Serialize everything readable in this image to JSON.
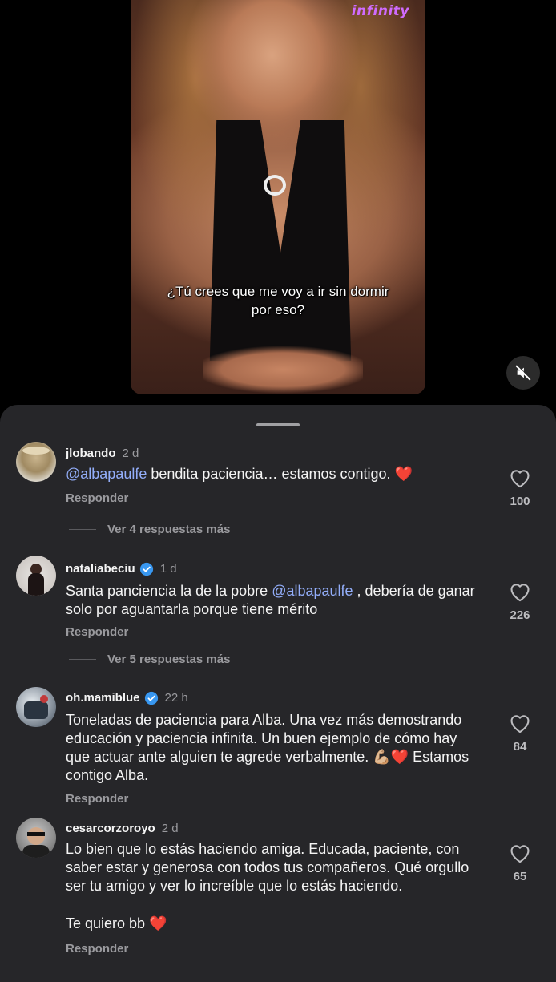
{
  "video": {
    "logo": "infinity",
    "subtitle": "¿Tú crees que me voy a ir sin dormir por eso?",
    "mute_icon": "speaker-muted-icon"
  },
  "comments": [
    {
      "username": "jlobando",
      "time": "2 d",
      "verified": false,
      "mention": "@albapaulfe",
      "text": " bendita paciencia… estamos contigo. ",
      "emoji": "❤️",
      "reply": "Responder",
      "likes": "100",
      "more_replies": "Ver 4 respuestas más"
    },
    {
      "username": "nataliabeciu",
      "time": "1 d",
      "verified": true,
      "text_before": "Santa panciencia la de la pobre ",
      "mention": "@albapaulfe",
      "text_after": " , debería de ganar solo por aguantarla porque tiene mérito",
      "reply": "Responder",
      "likes": "226",
      "more_replies": "Ver 5 respuestas más"
    },
    {
      "username": "oh.mamiblue",
      "time": "22 h",
      "verified": true,
      "text": "Toneladas de paciencia para Alba. Una vez más demostrando educación y paciencia infinita. Un buen ejemplo de cómo hay que actuar ante alguien te agrede verbalmente. ",
      "emoji": "💪🏼❤️",
      "text_end": " Estamos contigo Alba.",
      "reply": "Responder",
      "likes": "84"
    },
    {
      "username": "cesarcorzoroyo",
      "time": "2 d",
      "verified": false,
      "text": "Lo bien que lo estás haciendo amiga. Educada, paciente, con saber estar y generosa con todos tus compañeros. Qué orgullo ser tu amigo y ver lo increíble que lo estás haciendo.",
      "text2": "Te quiero bb ",
      "emoji": "❤️",
      "reply": "Responder",
      "likes": "65"
    }
  ],
  "colors": {
    "sheet_bg": "#262629",
    "mention": "#93aefa",
    "verified": "#3897f0",
    "secondary_text": "#9a9a9e"
  }
}
